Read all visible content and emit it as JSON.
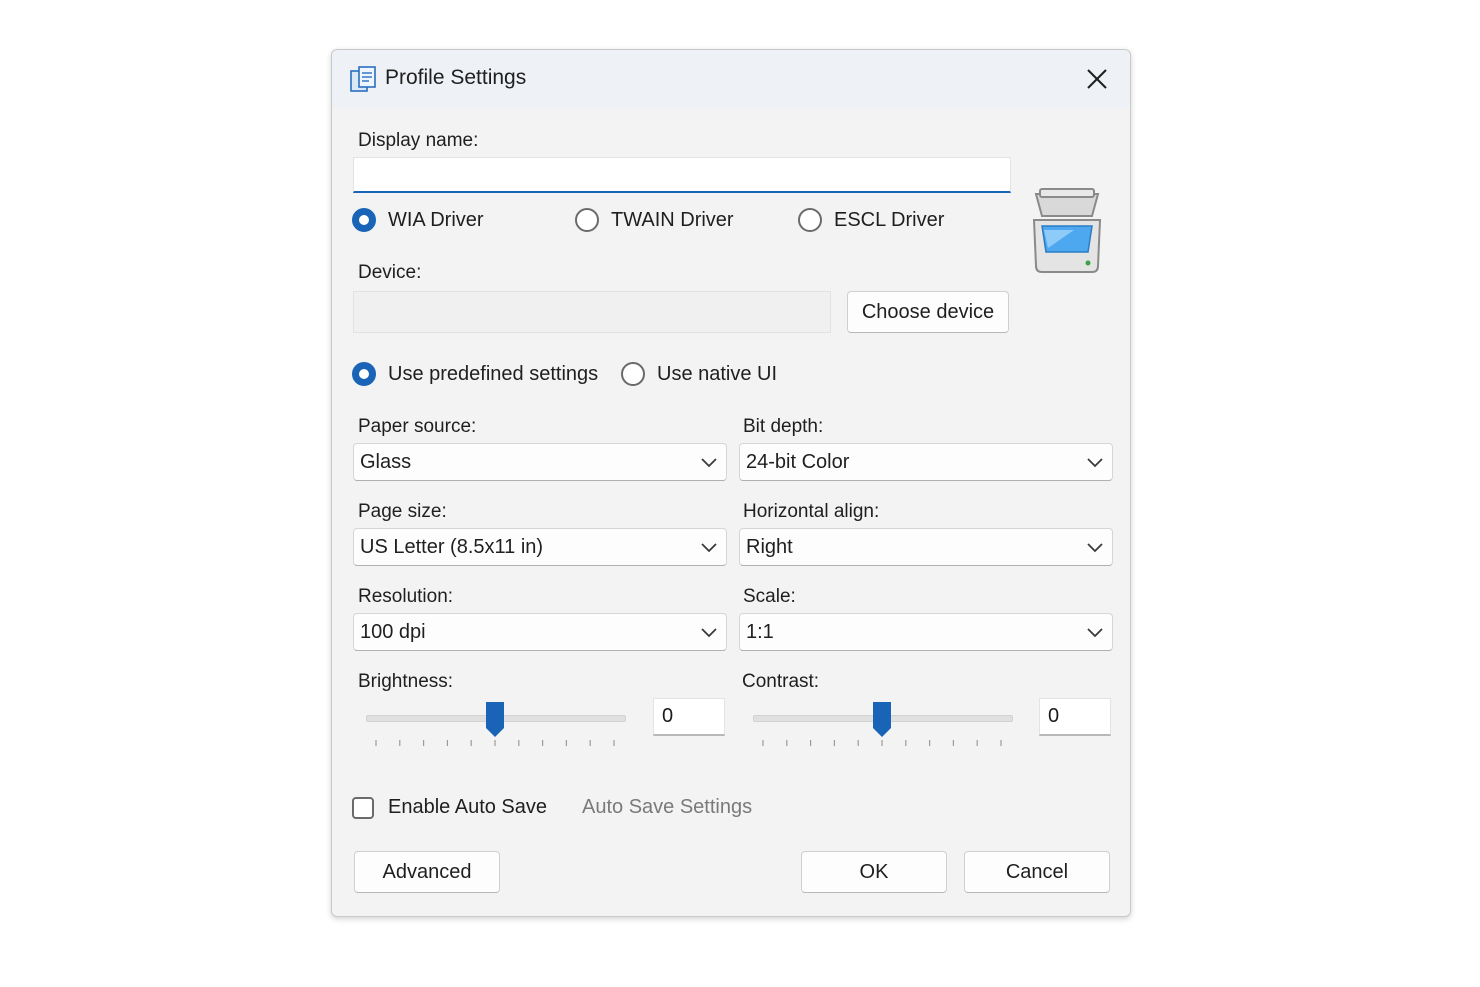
{
  "window": {
    "title": "Profile Settings"
  },
  "display_name": {
    "label": "Display name:",
    "value": ""
  },
  "driver": {
    "options": [
      "WIA Driver",
      "TWAIN Driver",
      "ESCL Driver"
    ],
    "selected": "WIA Driver"
  },
  "device": {
    "label": "Device:",
    "value": "",
    "choose_label": "Choose device"
  },
  "mode": {
    "options": [
      "Use predefined settings",
      "Use native UI"
    ],
    "selected": "Use predefined settings"
  },
  "paper_source": {
    "label": "Paper source:",
    "value": "Glass"
  },
  "bit_depth": {
    "label": "Bit depth:",
    "value": "24-bit Color"
  },
  "page_size": {
    "label": "Page size:",
    "value": "US Letter (8.5x11 in)"
  },
  "horizontal_align": {
    "label": "Horizontal align:",
    "value": "Right"
  },
  "resolution": {
    "label": "Resolution:",
    "value": "100 dpi"
  },
  "scale": {
    "label": "Scale:",
    "value": "1:1"
  },
  "brightness": {
    "label": "Brightness:",
    "value": "0",
    "slider_fraction": 0.5
  },
  "contrast": {
    "label": "Contrast:",
    "value": "0",
    "slider_fraction": 0.5
  },
  "auto_save": {
    "label": "Enable Auto Save",
    "checked": false,
    "settings_label": "Auto Save Settings"
  },
  "buttons": {
    "advanced": "Advanced",
    "ok": "OK",
    "cancel": "Cancel"
  },
  "colors": {
    "accent": "#1a64b8",
    "disabled_text": "#7a7a7a"
  },
  "icons": {
    "app": "scanner-profile-icon",
    "close": "close-icon",
    "device": "scanner-icon",
    "dropdown": "chevron-down-icon"
  }
}
